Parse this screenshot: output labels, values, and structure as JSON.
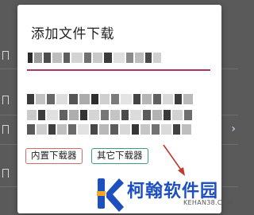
{
  "dialog": {
    "title": "添加文件下载",
    "url_value": "",
    "description_value": "",
    "buttons": {
      "builtin_downloader": "内置下载器",
      "other_downloader": "其它下载器"
    }
  },
  "watermark": {
    "name": "柯翰软件园",
    "url": "KEHAN38.COM"
  },
  "colors": {
    "input_underline": "#b0336a",
    "builtin_border": "#d36a6a",
    "other_border": "#3e9e78",
    "watermark_blue": "#1e4fbf",
    "annotation_arrow": "#c0392b"
  },
  "icons": [
    "bookmark-icon",
    "chevron-right-icon",
    "kehan-logo-icon"
  ]
}
